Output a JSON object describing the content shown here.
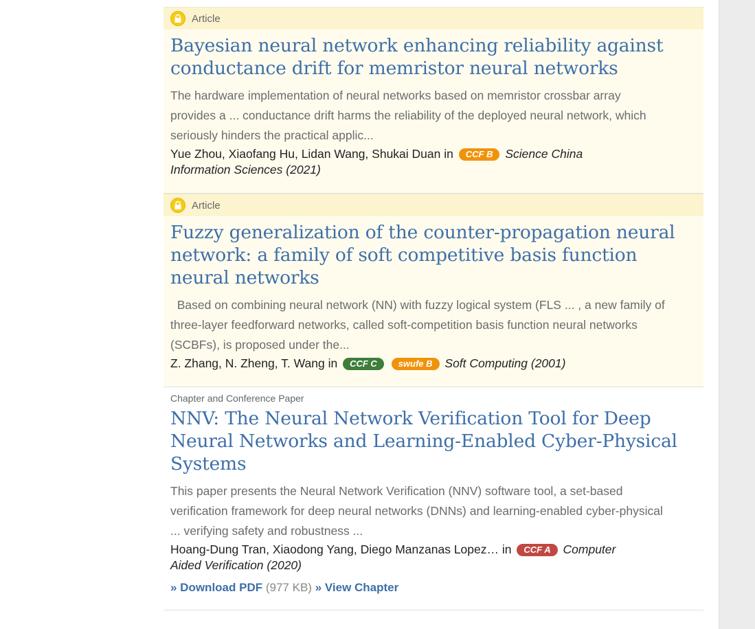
{
  "results": [
    {
      "type": "Article",
      "locked": true,
      "title": "Bayesian neural network enhancing reliability against conductance drift for memristor neural networks",
      "snippet": "The hardware implementation of neural networks based on memristor crossbar array provides a ... conductance drift harms the reliability of the deployed neural network, which seriously hinders the practical applic...",
      "authors": "Yue Zhou, Xiaofang Hu, Lidan Wang, Shukai Duan",
      "in_word": "in",
      "badges": [
        {
          "label": "CCF B",
          "color": "#f0930a"
        }
      ],
      "journal": "Science China Information Sciences (2021)"
    },
    {
      "type": "Article",
      "locked": true,
      "title": "Fuzzy generalization of the counter-propagation neural network: a family of soft competitive basis function neural networks",
      "snippet": "  Based on combining neural network (NN) with fuzzy logical system (FLS ... , a new family of three-layer feedforward networks, called soft-competition basis function neural networks (SCBFs), is proposed under the...",
      "authors": "Z. Zhang, N. Zheng, T. Wang",
      "in_word": "in",
      "badges": [
        {
          "label": "CCF C",
          "color": "#3e7d3a"
        },
        {
          "label": "swufe B",
          "color": "#f0930a"
        }
      ],
      "journal": "Soft Computing (2001)"
    },
    {
      "type": "Chapter and Conference Paper",
      "locked": false,
      "title": "NNV: The Neural Network Verification Tool for Deep Neural Networks and Learning-Enabled Cyber-Physical Systems",
      "snippet": "This paper presents the Neural Network Verification (NNV) software tool, a set-based verification framework for deep neural networks (DNNs) and learning-enabled cyber-physical ... verifying safety and robustness ...",
      "authors": "Hoang-Dung Tran, Xiaodong Yang, Diego Manzanas Lopez…",
      "in_word": "in",
      "badges": [
        {
          "label": "CCF A",
          "color": "#c14742"
        }
      ],
      "journal": "Computer Aided Verification (2020)",
      "download_label": "» Download PDF",
      "download_size": "(977 KB)",
      "view_label": "» View Chapter"
    }
  ]
}
